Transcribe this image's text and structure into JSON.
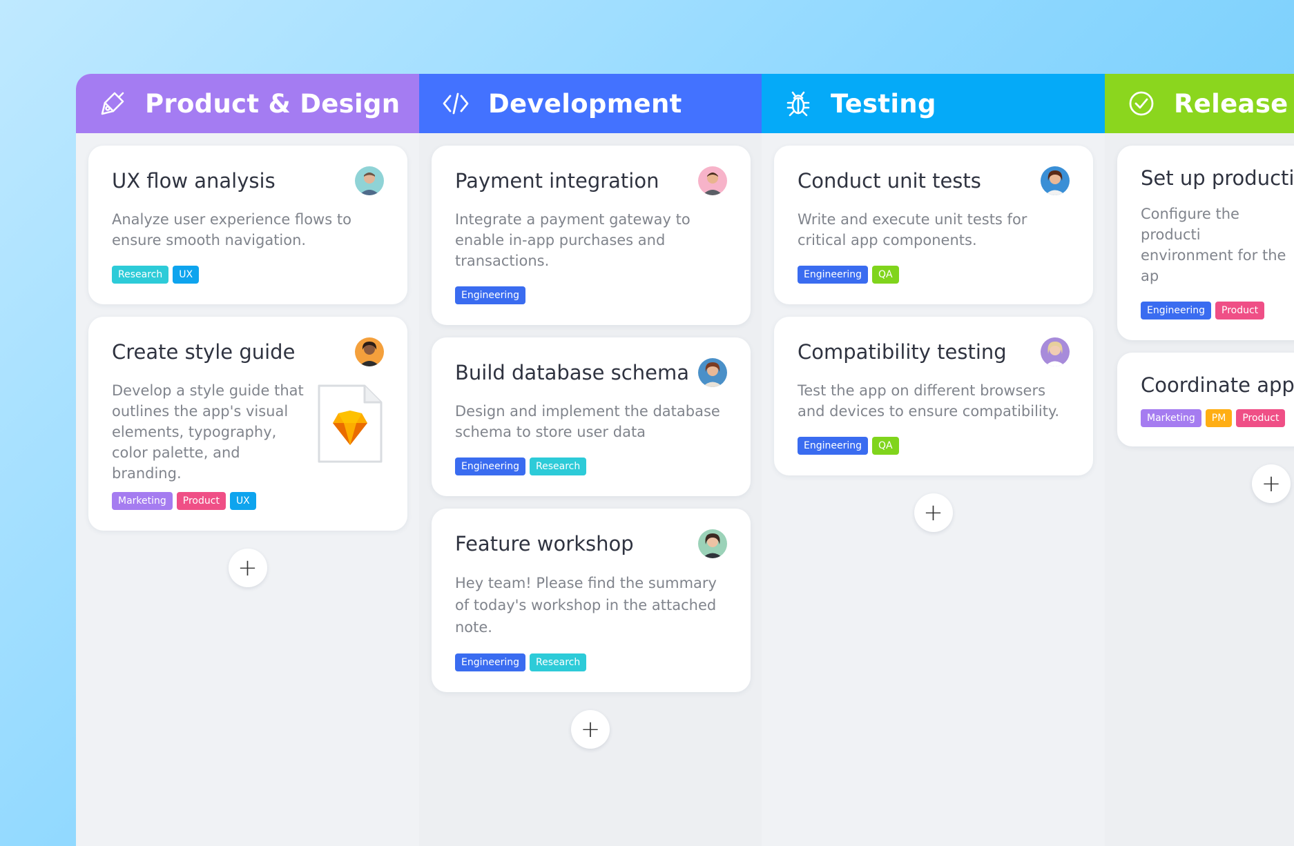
{
  "colors": {
    "product_design": "#a47cf2",
    "development": "#4372ff",
    "testing": "#05aaf8",
    "release": "#8bd61e",
    "tag_research": "#2dcbd8",
    "tag_ux": "#0ea4ee",
    "tag_engineering": "#3a6cf0",
    "tag_qa": "#80d41c",
    "tag_product": "#ef4f86",
    "tag_marketing": "#a57cf0",
    "tag_pm": "#ffae14"
  },
  "columns": [
    {
      "title": "Product & Design",
      "icon": "paint-brush-icon",
      "cards": [
        {
          "title": "UX flow analysis",
          "description": "Analyze user experience flows to ensure smooth navigation.",
          "tags": [
            "Research",
            "UX"
          ]
        },
        {
          "title": "Create style guide",
          "description": "Develop a style guide that outlines the app's visual elements, typography, color palette, and branding.",
          "attachment": "sketch-file-icon",
          "tags": [
            "Marketing",
            "Product",
            "UX"
          ]
        }
      ],
      "add_label": "+"
    },
    {
      "title": "Development",
      "icon": "code-icon",
      "cards": [
        {
          "title": "Payment integration",
          "description": "Integrate a payment gateway to enable in-app purchases and transactions.",
          "tags": [
            "Engineering"
          ]
        },
        {
          "title": "Build database schema",
          "description": "Design and implement the database schema to store user data",
          "tags": [
            "Engineering",
            "Research"
          ]
        },
        {
          "title": "Feature workshop",
          "description": "Hey team! Please find the summary of today's workshop in the attached note.",
          "tags": [
            "Engineering",
            "Research"
          ]
        }
      ],
      "add_label": "+"
    },
    {
      "title": "Testing",
      "icon": "bug-icon",
      "cards": [
        {
          "title": "Conduct unit tests",
          "description": "Write and execute unit tests for critical app components.",
          "tags": [
            "Engineering",
            "QA"
          ]
        },
        {
          "title": "Compatibility testing",
          "description": "Test the app on different browsers and devices to ensure compatibility.",
          "tags": [
            "Engineering",
            "QA"
          ]
        }
      ],
      "add_label": "+"
    },
    {
      "title": "Release",
      "icon": "check-circle-icon",
      "cards": [
        {
          "title": "Set up productio",
          "description": "Configure the producti environment for the ap",
          "tags": [
            "Engineering",
            "Product"
          ]
        },
        {
          "title": "Coordinate app",
          "tags": [
            "Marketing",
            "PM",
            "Product"
          ]
        }
      ],
      "add_label": "+"
    }
  ]
}
